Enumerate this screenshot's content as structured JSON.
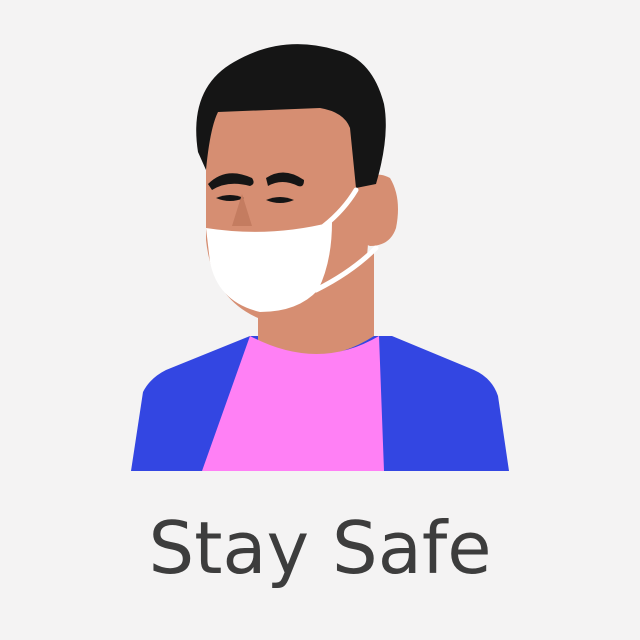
{
  "caption": "Stay Safe",
  "colors": {
    "background": "#f4f3f3",
    "hair": "#151515",
    "skin": "#d68e72",
    "nose": "#c47c60",
    "mask": "#ffffff",
    "shirt": "#ff80f5",
    "jacket": "#3346e2",
    "caption_text": "#3d3d3d"
  },
  "illustration": {
    "icons": [
      "person-icon",
      "face-mask-icon"
    ]
  }
}
